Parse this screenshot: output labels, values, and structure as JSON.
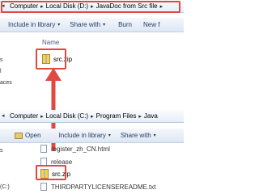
{
  "top_window": {
    "breadcrumb": [
      "Computer",
      "Local Disk (D:)",
      "JavaDoc from Src file"
    ],
    "toolbar": {
      "include": "Include in library",
      "share": "Share with",
      "burn": "Burn",
      "new": "New f"
    },
    "column_header": "Name",
    "sidebar_text": [
      "s",
      "l",
      "aces"
    ],
    "file": "src.zip"
  },
  "bottom_window": {
    "breadcrumb": [
      "Computer",
      "Local Disk (C:)",
      "Program Files",
      "Java"
    ],
    "toolbar": {
      "open": "Open",
      "include": "Include in library",
      "share": "Share with"
    },
    "files": [
      "register_zh_CN.html",
      "release",
      "src.zip",
      "THIRDPARTYLICENSEREADME.txt"
    ],
    "sidebar_text": [
      "s",
      "(C:)"
    ]
  },
  "colors": {
    "highlight": "#e04840",
    "arrow": "#e04840"
  }
}
